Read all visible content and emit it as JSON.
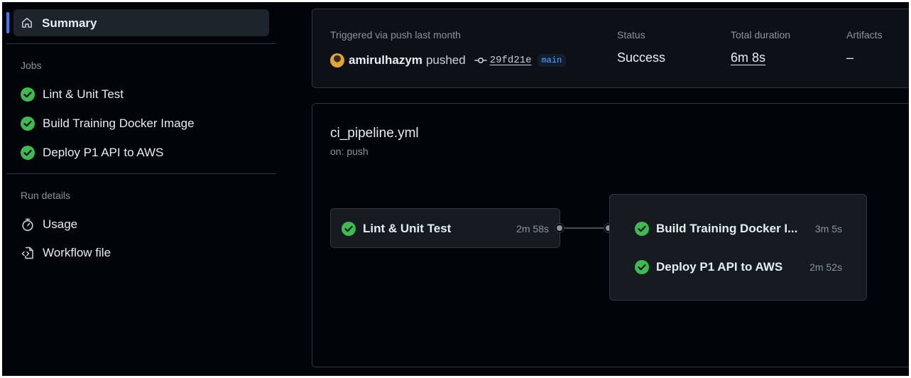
{
  "sidebar": {
    "summary_label": "Summary",
    "jobs_heading": "Jobs",
    "jobs": [
      {
        "label": "Lint & Unit Test"
      },
      {
        "label": "Build Training Docker Image"
      },
      {
        "label": "Deploy P1 API to AWS"
      }
    ],
    "run_details_heading": "Run details",
    "details": [
      {
        "label": "Usage",
        "icon": "stopwatch-icon"
      },
      {
        "label": "Workflow file",
        "icon": "file-code-icon"
      }
    ]
  },
  "summary_panel": {
    "trigger_text": "Triggered via push last month",
    "actor": "amirulhazym",
    "action": "pushed",
    "commit_sha": "29fd21e",
    "branch": "main",
    "status_label": "Status",
    "status_value": "Success",
    "duration_label": "Total duration",
    "duration_value": "6m 8s",
    "artifacts_label": "Artifacts",
    "artifacts_value": "–"
  },
  "workflow": {
    "file_name": "ci_pipeline.yml",
    "trigger": "on: push",
    "jobs": [
      {
        "name": "Lint & Unit Test",
        "duration": "2m 58s",
        "status": "success"
      },
      {
        "name": "Build Training Docker I...",
        "duration": "3m 5s",
        "status": "success"
      },
      {
        "name": "Deploy P1 API to AWS",
        "duration": "2m 52s",
        "status": "success"
      }
    ]
  },
  "colors": {
    "accent": "#2f81f7",
    "success": "#3fb950",
    "background": "#010409",
    "panel": "#0d1117"
  }
}
